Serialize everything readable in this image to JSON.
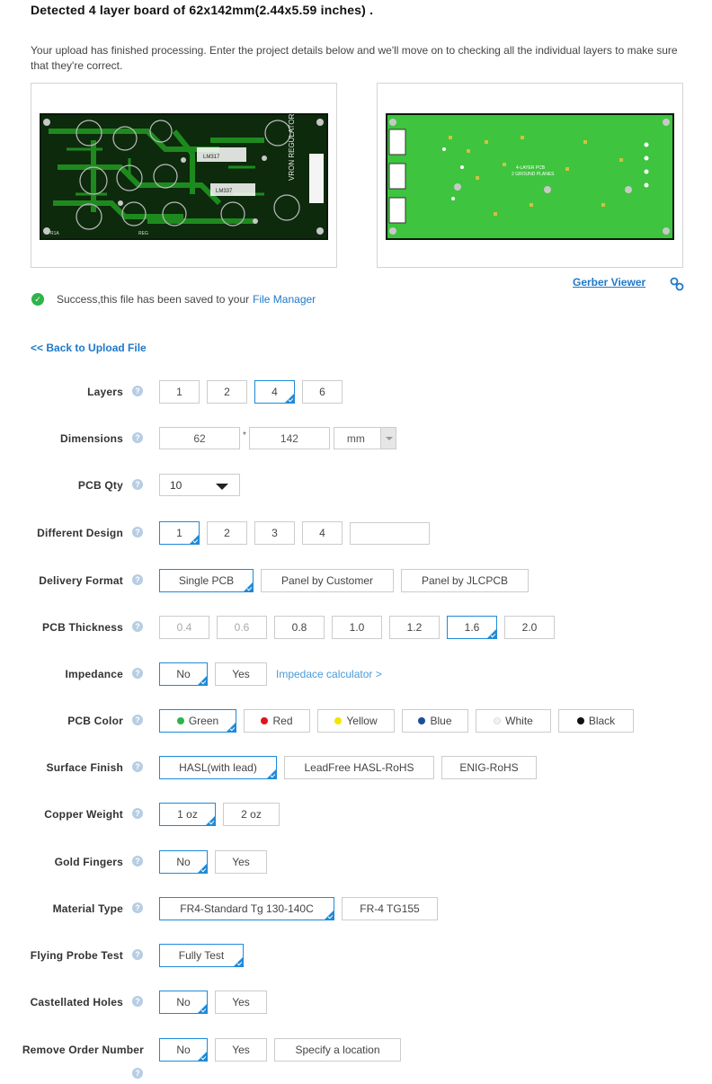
{
  "heading": "Detected 4 layer board of 62x142mm(2.44x5.59 inches) .",
  "intro": "Your upload has finished processing. Enter the project details below and we'll move on to checking all the individual layers to make sure that they're correct.",
  "preview": {
    "top_board_texts": [
      "VRON REGULATOR",
      "LM317",
      "LM337",
      "R1A",
      "REG"
    ],
    "bottom_board_texts": [
      "4-LAYER PCB",
      "2 GROUND PLANES"
    ],
    "colors": {
      "board_green": "#1e8a1e",
      "board_bright": "#3ec43e",
      "board_bg": "#0a1a0a"
    }
  },
  "gerber_viewer": "Gerber Viewer",
  "success": {
    "text": "Success,this file has been saved to your",
    "link": "File Manager"
  },
  "back_link": "<< Back to Upload File",
  "colors": {
    "accent": "#1f8ad8",
    "link": "#1f78c8",
    "success": "#2fb34a",
    "help": "#b7cde3"
  },
  "form": {
    "layers": {
      "label": "Layers",
      "options": [
        "1",
        "2",
        "4",
        "6"
      ],
      "selected": "4"
    },
    "dimensions": {
      "label": "Dimensions",
      "width": "62",
      "height": "142",
      "separator": "*",
      "unit": "mm"
    },
    "qty": {
      "label": "PCB Qty",
      "value": "10"
    },
    "different_design": {
      "label": "Different Design",
      "options": [
        "1",
        "2",
        "3",
        "4"
      ],
      "selected": "1",
      "custom_value": ""
    },
    "delivery": {
      "label": "Delivery Format",
      "options": [
        "Single PCB",
        "Panel by Customer",
        "Panel by JLCPCB"
      ],
      "selected": "Single PCB"
    },
    "thickness": {
      "label": "PCB Thickness",
      "options": [
        "0.4",
        "0.6",
        "0.8",
        "1.0",
        "1.2",
        "1.6",
        "2.0"
      ],
      "selected": "1.6",
      "disabled": [
        "0.4",
        "0.6"
      ]
    },
    "impedance": {
      "label": "Impedance",
      "options": [
        "No",
        "Yes"
      ],
      "selected": "No",
      "link": "Impedace calculator >"
    },
    "color": {
      "label": "PCB Color",
      "options": [
        {
          "name": "Green",
          "hex": "#2fb34a"
        },
        {
          "name": "Red",
          "hex": "#e0141e"
        },
        {
          "name": "Yellow",
          "hex": "#f2e600"
        },
        {
          "name": "Blue",
          "hex": "#1b4e9c"
        },
        {
          "name": "White",
          "hex": "#f2f2f2"
        },
        {
          "name": "Black",
          "hex": "#111111"
        }
      ],
      "selected": "Green"
    },
    "surface": {
      "label": "Surface Finish",
      "options": [
        "HASL(with lead)",
        "LeadFree HASL-RoHS",
        "ENIG-RoHS"
      ],
      "selected": "HASL(with lead)"
    },
    "copper": {
      "label": "Copper Weight",
      "options": [
        "1 oz",
        "2 oz"
      ],
      "selected": "1 oz"
    },
    "gold": {
      "label": "Gold Fingers",
      "options": [
        "No",
        "Yes"
      ],
      "selected": "No"
    },
    "material": {
      "label": "Material Type",
      "options": [
        "FR4-Standard Tg 130-140C",
        "FR-4 TG155"
      ],
      "selected": "FR4-Standard Tg 130-140C"
    },
    "probe": {
      "label": "Flying Probe Test",
      "options": [
        "Fully Test"
      ],
      "selected": "Fully Test"
    },
    "castellated": {
      "label": "Castellated Holes",
      "options": [
        "No",
        "Yes"
      ],
      "selected": "No"
    },
    "order_number": {
      "label": "Remove Order Number",
      "options": [
        "No",
        "Yes",
        "Specify a location"
      ],
      "selected": "No"
    }
  }
}
